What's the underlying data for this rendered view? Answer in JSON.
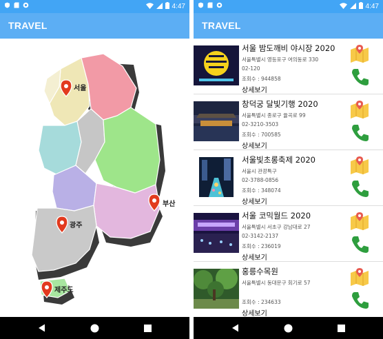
{
  "status_bar": {
    "time": "4:47"
  },
  "left_screen": {
    "app_title": "TRAVEL",
    "map": {
      "markers": [
        {
          "label": "서울"
        },
        {
          "label": "부산"
        },
        {
          "label": "광주"
        },
        {
          "label": "제주도"
        }
      ]
    }
  },
  "right_screen": {
    "app_title": "TRAVEL",
    "items": [
      {
        "name": "서울 밤도깨비 야시장 2020",
        "address": "서울특별시 영등포구 여의동로 330",
        "tel": "02-120",
        "views": "조회수 : 944858",
        "more": "상세보기"
      },
      {
        "name": "창덕궁 달빛기행 2020",
        "address": "서울특별시 종로구 율곡로 99",
        "tel": "02-3210-3503",
        "views": "조회수 : 700585",
        "more": "상세보기"
      },
      {
        "name": "서울빛초롱축제 2020",
        "address": "서울시 관광특구",
        "tel": "02-3788-0856",
        "views": "조회수 : 348074",
        "more": "상세보기"
      },
      {
        "name": "서울 코믹월드 2020",
        "address": "서울특별시 서초구 강남대로 27",
        "tel": "02-3142-2137",
        "views": "조회수 : 236019",
        "more": "상세보기"
      },
      {
        "name": "홍릉수목원",
        "address": "서울특별시 동대문구 회기로 57",
        "tel": "",
        "views": "조회수 : 234633",
        "more": "상세보기"
      }
    ]
  },
  "colors": {
    "status_bar": "#42a5f5",
    "app_bar": "#5caef4",
    "call_green": "#2e9e3e",
    "marker_red": "#e23a1e"
  },
  "icons": [
    "notification-icon",
    "sd-card-icon",
    "sync-icon",
    "wifi-icon",
    "signal-icon",
    "battery-icon",
    "map-icon",
    "phone-icon",
    "back-icon",
    "home-icon",
    "recent-icon",
    "location-pin-icon"
  ]
}
